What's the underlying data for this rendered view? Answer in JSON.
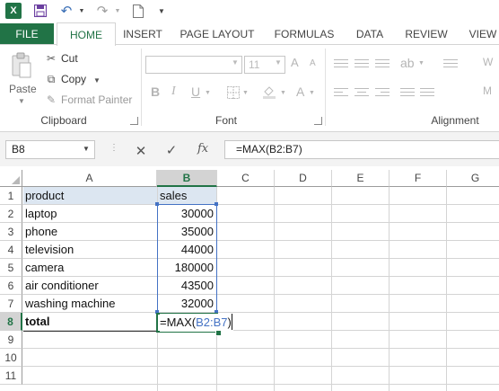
{
  "app": {
    "logo_letter": "X",
    "accent_color": "#217346"
  },
  "quick_access": {
    "icons": [
      "excel-logo-icon",
      "save-icon",
      "undo-icon",
      "redo-icon",
      "new-document-icon",
      "customize-toolbar-icon"
    ]
  },
  "tabs": {
    "file": "FILE",
    "home": "HOME",
    "insert": "INSERT",
    "page_layout": "PAGE LAYOUT",
    "formulas": "FORMULAS",
    "data": "DATA",
    "review": "REVIEW",
    "view": "VIEW",
    "active": "HOME"
  },
  "ribbon": {
    "clipboard": {
      "paste": "Paste",
      "cut": "Cut",
      "copy": "Copy",
      "format_painter": "Format Painter",
      "group_label": "Clipboard"
    },
    "font": {
      "font_name": "",
      "font_size": "11",
      "bold": "B",
      "italic": "I",
      "underline": "U",
      "grow": "A",
      "shrink": "A",
      "font_color": "A",
      "group_label": "Font"
    },
    "alignment": {
      "group_label": "Alignment"
    }
  },
  "formula_bar": {
    "name_box": "B8",
    "cancel_icon": "✕",
    "enter_icon": "✓",
    "fx": "fx",
    "formula": "=MAX(B2:B7)"
  },
  "sheet": {
    "active_cell": "B8",
    "columns": [
      "A",
      "B",
      "C",
      "D",
      "E",
      "F",
      "G"
    ],
    "row_numbers": [
      "1",
      "2",
      "3",
      "4",
      "5",
      "6",
      "7",
      "8",
      "9",
      "10",
      "11"
    ],
    "header_row": {
      "a": "product",
      "b": "sales"
    },
    "rows": [
      {
        "a": "laptop",
        "b": "30000"
      },
      {
        "a": "phone",
        "b": "35000"
      },
      {
        "a": "television",
        "b": "44000"
      },
      {
        "a": "camera",
        "b": "180000"
      },
      {
        "a": "air conditioner",
        "b": "43500"
      },
      {
        "a": "washing machine",
        "b": "32000"
      }
    ],
    "total_label": "total",
    "b8_formula_prefix": "=MAX(",
    "b8_formula_ref": "B2:B7",
    "b8_formula_suffix": ")"
  }
}
